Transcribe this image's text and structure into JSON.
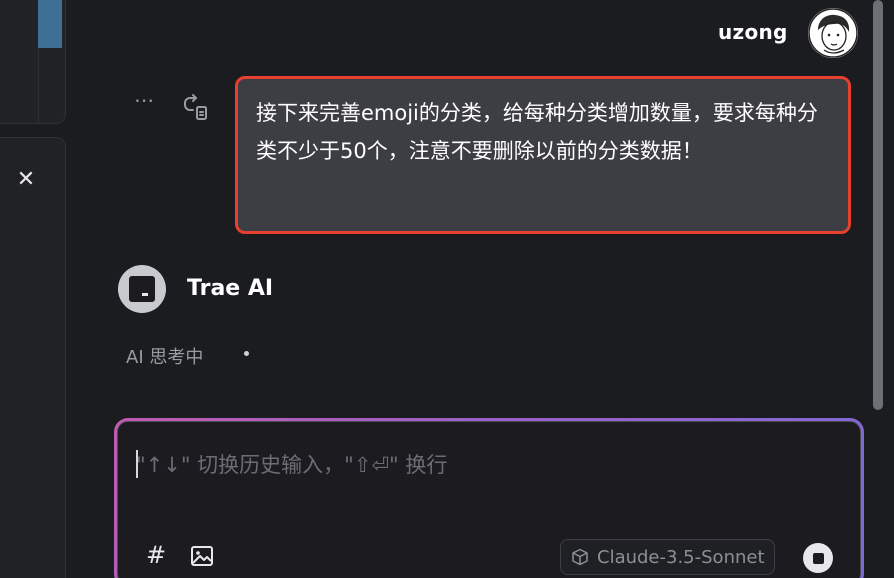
{
  "user": {
    "name": "uzong"
  },
  "message": {
    "text": "接下来完善emoji的分类，给每种分类增加数量，要求每种分类不少于50个，注意不要删除以前的分类数据！"
  },
  "ai": {
    "name": "Trae AI",
    "status": "AI 思考中"
  },
  "input": {
    "placeholder": "\"↑↓\" 切换历史输入，\"⇧⏎\" 换行",
    "value": ""
  },
  "toolbar": {
    "hash_glyph": "#",
    "close_glyph": "✕",
    "more_glyph": "⋯"
  },
  "model": {
    "name": "Claude-3.5-Sonnet"
  },
  "colors": {
    "highlight_border": "#e8402e",
    "bubble_bg": "#3d3e44",
    "input_glow": "#9b5fc9"
  },
  "icons": [
    "close-icon",
    "more-icon",
    "retry-icon",
    "hash-icon",
    "image-icon",
    "cube-icon",
    "stop-icon"
  ]
}
